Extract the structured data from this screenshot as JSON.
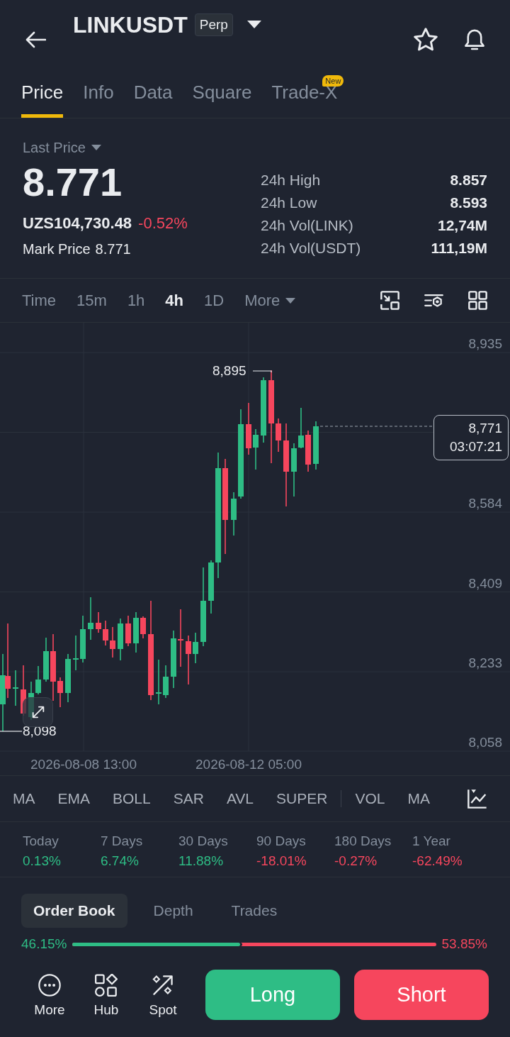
{
  "header": {
    "title": "LINKUSDT",
    "badge": "Perp"
  },
  "tabs": [
    {
      "label": "Price",
      "selected": true
    },
    {
      "label": "Info",
      "selected": false
    },
    {
      "label": "Data",
      "selected": false
    },
    {
      "label": "Square",
      "selected": false
    },
    {
      "label": "Trade-X",
      "selected": false,
      "badge": "New"
    }
  ],
  "ticker": {
    "price_type": "Last Price",
    "last_price": "8.771",
    "fiat_price": "UZS104,730.48",
    "change": "-0.52%",
    "negative": true,
    "mark_price_label": "Mark Price",
    "mark_price": "8.771",
    "stats": [
      {
        "label": "24h High",
        "value": "8.857"
      },
      {
        "label": "24h Low",
        "value": "8.593"
      },
      {
        "label": "24h Vol(LINK)",
        "value": "12,74M"
      },
      {
        "label": "24h Vol(USDT)",
        "value": "111,19M"
      }
    ]
  },
  "intervals": [
    {
      "label": "Time",
      "selected": false
    },
    {
      "label": "15m",
      "selected": false
    },
    {
      "label": "1h",
      "selected": false
    },
    {
      "label": "4h",
      "selected": true
    },
    {
      "label": "1D",
      "selected": false
    }
  ],
  "more_intervals": {
    "label": "More"
  },
  "chart": {
    "y_axis": [
      "8,935",
      "8,584",
      "8,409",
      "8,233",
      "8,058"
    ],
    "high_label": "8,895",
    "low_label": "8,098",
    "current_price": "8,771",
    "countdown": "03:07:21",
    "x_axis": [
      "2026-08-08 13:00",
      "2026-08-12 05:00"
    ]
  },
  "indicators": {
    "main": [
      "MA",
      "EMA",
      "BOLL",
      "SAR",
      "AVL",
      "SUPER"
    ],
    "sub": [
      "VOL",
      "MA"
    ]
  },
  "performance": [
    {
      "period": "Today",
      "change": "0.13%",
      "color": "#2ebd85"
    },
    {
      "period": "7 Days",
      "change": "6.74%",
      "color": "#2ebd85"
    },
    {
      "period": "30 Days",
      "change": "11.88%",
      "color": "#2ebd85"
    },
    {
      "period": "90 Days",
      "change": "-18.01%",
      "color": "#f6465d"
    },
    {
      "period": "180 Days",
      "change": "-0.27%",
      "color": "#f6465d"
    },
    {
      "period": "1 Year",
      "change": "-62.49%",
      "color": "#f6465d"
    }
  ],
  "order_book": {
    "tabs": [
      {
        "label": "Order Book",
        "selected": true
      },
      {
        "label": "Depth",
        "selected": false
      },
      {
        "label": "Trades",
        "selected": false
      }
    ],
    "buy_ratio": "46.15%",
    "sell_ratio": "53.85%",
    "level": 0.4615
  },
  "bottom_nav": [
    {
      "label": "More",
      "kind": "dots"
    },
    {
      "label": "Hub",
      "kind": "shapes"
    },
    {
      "label": "Spot",
      "kind": "arrow"
    }
  ],
  "trade_buttons": [
    {
      "label": "Long",
      "kind": "buy"
    },
    {
      "label": "Short",
      "kind": "sell"
    }
  ]
}
